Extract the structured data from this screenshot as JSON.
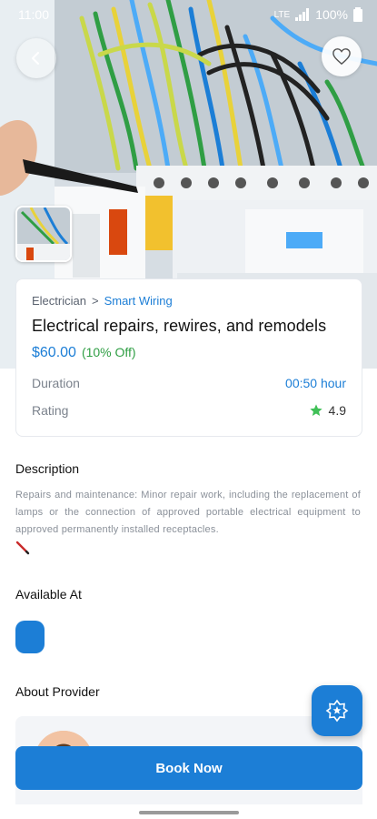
{
  "status_bar": {
    "time": "11:00",
    "network": "LTE",
    "battery": "100%"
  },
  "service": {
    "category": "Electrician",
    "separator": ">",
    "subcategory": "Smart Wiring",
    "title": "Electrical repairs, rewires, and remodels",
    "price": "$60.00",
    "discount": "(10% Off)",
    "duration_label": "Duration",
    "duration_value": "00:50 hour",
    "rating_label": "Rating",
    "rating_value": "4.9"
  },
  "description": {
    "title": "Description",
    "text": "Repairs and maintenance: Minor repair work, including the replacement of lamps or the connection of approved portable electrical equipment to approved permanently installed receptacles."
  },
  "available_at": {
    "title": "Available At"
  },
  "about_provider": {
    "title": "About Provider"
  },
  "actions": {
    "book_now": "Book Now"
  },
  "colors": {
    "accent": "#1c7ed6",
    "discount": "#2f9e44",
    "star": "#40c057"
  },
  "icons": {
    "back": "chevron-left-icon",
    "favorite": "heart-icon",
    "rating": "star-icon",
    "fab": "star-badge-icon"
  }
}
